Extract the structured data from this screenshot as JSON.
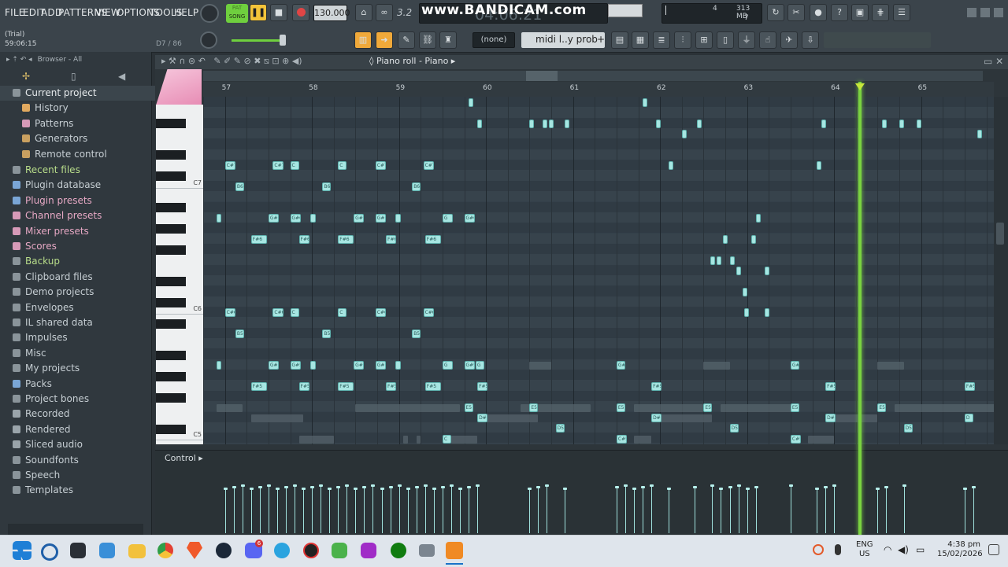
{
  "menu": [
    "FILE",
    "EDIT",
    "ADD",
    "PATTERNS",
    "VIEW",
    "OPTIONS",
    "TOOLS",
    "HELP"
  ],
  "transport": {
    "mode_label": "SONG",
    "mode_pat": "PAT",
    "tempo": "130.000",
    "time": "04:06:21",
    "pattern_num": "3.2"
  },
  "watermark": "www.BANDICAM.com",
  "cpu": {
    "value": "4",
    "memory": "313 MB",
    "voices": "7"
  },
  "hint": {
    "line1": "(Trial)",
    "line2": "59:06:15",
    "note": "D7 / 86"
  },
  "toolbar2": {
    "none_label": "(none)",
    "pattern_label": "midi l..y prob",
    "add_label": "+"
  },
  "browser": {
    "title": "Browser - All",
    "items": [
      {
        "label": "Current project",
        "style": "white",
        "indent": 0,
        "icon": "folder-icon"
      },
      {
        "label": "History",
        "style": "white",
        "indent": 1,
        "icon": "history-icon"
      },
      {
        "label": "Patterns",
        "style": "white",
        "indent": 1,
        "icon": "note-icon"
      },
      {
        "label": "Generators",
        "style": "white",
        "indent": 1,
        "icon": "generator-icon"
      },
      {
        "label": "Remote control",
        "style": "white",
        "indent": 1,
        "icon": "remote-icon"
      },
      {
        "label": "Recent files",
        "style": "green",
        "indent": 0,
        "icon": "folder-icon"
      },
      {
        "label": "Plugin database",
        "style": "white",
        "indent": 0,
        "icon": "plug-icon"
      },
      {
        "label": "Plugin presets",
        "style": "pink",
        "indent": 0,
        "icon": "plug-icon"
      },
      {
        "label": "Channel presets",
        "style": "pink",
        "indent": 0,
        "icon": "channel-icon"
      },
      {
        "label": "Mixer presets",
        "style": "pink",
        "indent": 0,
        "icon": "mixer-icon"
      },
      {
        "label": "Scores",
        "style": "pink",
        "indent": 0,
        "icon": "note-icon"
      },
      {
        "label": "Backup",
        "style": "green",
        "indent": 0,
        "icon": "folder-icon"
      },
      {
        "label": "Clipboard files",
        "style": "white",
        "indent": 0,
        "icon": "folder-icon"
      },
      {
        "label": "Demo projects",
        "style": "white",
        "indent": 0,
        "icon": "folder-icon"
      },
      {
        "label": "Envelopes",
        "style": "white",
        "indent": 0,
        "icon": "folder-icon"
      },
      {
        "label": "IL shared data",
        "style": "white",
        "indent": 0,
        "icon": "folder-icon"
      },
      {
        "label": "Impulses",
        "style": "white",
        "indent": 0,
        "icon": "folder-icon"
      },
      {
        "label": "Misc",
        "style": "white",
        "indent": 0,
        "icon": "folder-icon"
      },
      {
        "label": "My projects",
        "style": "white",
        "indent": 0,
        "icon": "folder-icon"
      },
      {
        "label": "Packs",
        "style": "white",
        "indent": 0,
        "icon": "pack-icon"
      },
      {
        "label": "Project bones",
        "style": "white",
        "indent": 0,
        "icon": "folder-icon"
      },
      {
        "label": "Recorded",
        "style": "white",
        "indent": 0,
        "icon": "plus-icon"
      },
      {
        "label": "Rendered",
        "style": "white",
        "indent": 0,
        "icon": "plus-icon"
      },
      {
        "label": "Sliced audio",
        "style": "white",
        "indent": 0,
        "icon": "plus-icon"
      },
      {
        "label": "Soundfonts",
        "style": "white",
        "indent": 0,
        "icon": "folder-icon"
      },
      {
        "label": "Speech",
        "style": "white",
        "indent": 0,
        "icon": "folder-icon"
      },
      {
        "label": "Templates",
        "style": "white",
        "indent": 0,
        "icon": "folder-icon"
      }
    ]
  },
  "pianoroll": {
    "title": "Piano roll - Piano",
    "control_label": "Control",
    "bars": [
      "57",
      "58",
      "59",
      "60",
      "61",
      "62",
      "63",
      "64",
      "65"
    ],
    "key_labels": [
      "C7",
      "C6",
      "C5"
    ],
    "playhead_bar": 64.3
  },
  "notes": [
    {
      "b": 57.0,
      "r": 7,
      "w": 0.12,
      "t": "C#7"
    },
    {
      "b": 57.55,
      "r": 7,
      "w": 0.12,
      "t": "C#7"
    },
    {
      "b": 57.75,
      "r": 7,
      "w": 0.1,
      "t": "C"
    },
    {
      "b": 58.3,
      "r": 7,
      "w": 0.1,
      "t": "C"
    },
    {
      "b": 58.73,
      "r": 7,
      "w": 0.12,
      "t": "C#7"
    },
    {
      "b": 59.28,
      "r": 7,
      "w": 0.12,
      "t": "C#7"
    },
    {
      "b": 57.12,
      "r": 9,
      "w": 0.1,
      "t": "B6"
    },
    {
      "b": 58.12,
      "r": 9,
      "w": 0.1,
      "t": "B6"
    },
    {
      "b": 59.15,
      "r": 9,
      "w": 0.1,
      "t": "B6"
    },
    {
      "b": 56.9,
      "r": 12,
      "w": 0.05,
      "t": ""
    },
    {
      "b": 57.5,
      "r": 12,
      "w": 0.12,
      "t": "G#6"
    },
    {
      "b": 57.75,
      "r": 12,
      "w": 0.12,
      "t": "G#6"
    },
    {
      "b": 57.98,
      "r": 12,
      "w": 0.06,
      "t": ""
    },
    {
      "b": 58.48,
      "r": 12,
      "w": 0.12,
      "t": "G#6"
    },
    {
      "b": 58.73,
      "r": 12,
      "w": 0.12,
      "t": "G#6"
    },
    {
      "b": 58.96,
      "r": 12,
      "w": 0.06,
      "t": ""
    },
    {
      "b": 59.5,
      "r": 12,
      "w": 0.12,
      "t": "G"
    },
    {
      "b": 59.75,
      "r": 12,
      "w": 0.12,
      "t": "G#6"
    },
    {
      "b": 57.3,
      "r": 14,
      "w": 0.18,
      "t": "F#6"
    },
    {
      "b": 57.85,
      "r": 14,
      "w": 0.12,
      "t": "F#6"
    },
    {
      "b": 58.3,
      "r": 14,
      "w": 0.18,
      "t": "F#6"
    },
    {
      "b": 58.85,
      "r": 14,
      "w": 0.12,
      "t": "F#6"
    },
    {
      "b": 59.3,
      "r": 14,
      "w": 0.18,
      "t": "F#6"
    },
    {
      "b": 57.0,
      "r": 21,
      "w": 0.12,
      "t": "C#6"
    },
    {
      "b": 57.55,
      "r": 21,
      "w": 0.12,
      "t": "C#6"
    },
    {
      "b": 57.75,
      "r": 21,
      "w": 0.1,
      "t": "C"
    },
    {
      "b": 58.3,
      "r": 21,
      "w": 0.1,
      "t": "C"
    },
    {
      "b": 58.73,
      "r": 21,
      "w": 0.12,
      "t": "C#6"
    },
    {
      "b": 59.28,
      "r": 21,
      "w": 0.12,
      "t": "C#6"
    },
    {
      "b": 57.12,
      "r": 23,
      "w": 0.1,
      "t": "B5"
    },
    {
      "b": 58.12,
      "r": 23,
      "w": 0.1,
      "t": "B5"
    },
    {
      "b": 59.15,
      "r": 23,
      "w": 0.1,
      "t": "B5"
    },
    {
      "b": 56.9,
      "r": 26,
      "w": 0.05,
      "t": ""
    },
    {
      "b": 57.5,
      "r": 26,
      "w": 0.12,
      "t": "G#5"
    },
    {
      "b": 57.75,
      "r": 26,
      "w": 0.12,
      "t": "G#5"
    },
    {
      "b": 57.98,
      "r": 26,
      "w": 0.06,
      "t": ""
    },
    {
      "b": 58.48,
      "r": 26,
      "w": 0.12,
      "t": "G#5"
    },
    {
      "b": 58.73,
      "r": 26,
      "w": 0.12,
      "t": "G#5"
    },
    {
      "b": 58.96,
      "r": 26,
      "w": 0.06,
      "t": ""
    },
    {
      "b": 59.5,
      "r": 26,
      "w": 0.12,
      "t": "G"
    },
    {
      "b": 59.75,
      "r": 26,
      "w": 0.12,
      "t": "G#5"
    },
    {
      "b": 59.88,
      "r": 26,
      "w": 0.1,
      "t": "G"
    },
    {
      "b": 61.5,
      "r": 26,
      "w": 0.1,
      "t": "G#"
    },
    {
      "b": 63.5,
      "r": 26,
      "w": 0.1,
      "t": "G#"
    },
    {
      "b": 57.3,
      "r": 28,
      "w": 0.18,
      "t": "F#5"
    },
    {
      "b": 57.85,
      "r": 28,
      "w": 0.12,
      "t": "F#5"
    },
    {
      "b": 58.3,
      "r": 28,
      "w": 0.18,
      "t": "F#5"
    },
    {
      "b": 58.85,
      "r": 28,
      "w": 0.12,
      "t": "F#5"
    },
    {
      "b": 59.3,
      "r": 28,
      "w": 0.18,
      "t": "F#5"
    },
    {
      "b": 59.9,
      "r": 28,
      "w": 0.12,
      "t": "F#5"
    },
    {
      "b": 61.9,
      "r": 28,
      "w": 0.12,
      "t": "F#5"
    },
    {
      "b": 63.9,
      "r": 28,
      "w": 0.12,
      "t": "F#5"
    },
    {
      "b": 65.5,
      "r": 28,
      "w": 0.12,
      "t": "F#5"
    },
    {
      "b": 59.75,
      "r": 30,
      "w": 0.1,
      "t": "E5"
    },
    {
      "b": 60.5,
      "r": 30,
      "w": 0.1,
      "t": "E5"
    },
    {
      "b": 61.5,
      "r": 30,
      "w": 0.1,
      "t": "E5"
    },
    {
      "b": 62.5,
      "r": 30,
      "w": 0.1,
      "t": "E5"
    },
    {
      "b": 63.5,
      "r": 30,
      "w": 0.1,
      "t": "E5"
    },
    {
      "b": 64.5,
      "r": 30,
      "w": 0.1,
      "t": "E5"
    },
    {
      "b": 59.9,
      "r": 31,
      "w": 0.12,
      "t": "D#5"
    },
    {
      "b": 61.9,
      "r": 31,
      "w": 0.12,
      "t": "D#5"
    },
    {
      "b": 63.9,
      "r": 31,
      "w": 0.12,
      "t": "D#5"
    },
    {
      "b": 65.5,
      "r": 31,
      "w": 0.1,
      "t": "D"
    },
    {
      "b": 60.8,
      "r": 32,
      "w": 0.1,
      "t": "D5"
    },
    {
      "b": 62.8,
      "r": 32,
      "w": 0.1,
      "t": "D5"
    },
    {
      "b": 64.8,
      "r": 32,
      "w": 0.1,
      "t": "D5"
    },
    {
      "b": 59.5,
      "r": 33,
      "w": 0.1,
      "t": "C"
    },
    {
      "b": 61.5,
      "r": 33,
      "w": 0.12,
      "t": "C#5"
    },
    {
      "b": 63.5,
      "r": 33,
      "w": 0.12,
      "t": "C#5"
    },
    {
      "b": 59.9,
      "r": 34,
      "w": 0.12,
      "t": "C5"
    },
    {
      "b": 61.9,
      "r": 34,
      "w": 0.12,
      "t": "C5"
    },
    {
      "b": 63.9,
      "r": 34,
      "w": 0.1,
      "t": "C5"
    },
    {
      "b": 65.5,
      "r": 34,
      "w": 0.1,
      "t": "C5"
    }
  ],
  "small_notes": [
    {
      "b": 59.8,
      "r": 1
    },
    {
      "b": 61.8,
      "r": 1
    },
    {
      "b": 59.9,
      "r": 3
    },
    {
      "b": 60.5,
      "r": 3
    },
    {
      "b": 60.65,
      "r": 3
    },
    {
      "b": 60.72,
      "r": 3
    },
    {
      "b": 60.9,
      "r": 3
    },
    {
      "b": 61.95,
      "r": 3
    },
    {
      "b": 62.42,
      "r": 3
    },
    {
      "b": 63.85,
      "r": 3
    },
    {
      "b": 64.55,
      "r": 3
    },
    {
      "b": 64.75,
      "r": 3
    },
    {
      "b": 64.95,
      "r": 3
    },
    {
      "b": 62.25,
      "r": 4
    },
    {
      "b": 65.65,
      "r": 4
    },
    {
      "b": 62.1,
      "r": 7
    },
    {
      "b": 63.8,
      "r": 7
    },
    {
      "b": 63.1,
      "r": 12
    },
    {
      "b": 62.72,
      "r": 14
    },
    {
      "b": 63.05,
      "r": 14
    },
    {
      "b": 62.58,
      "r": 16
    },
    {
      "b": 62.65,
      "r": 16
    },
    {
      "b": 62.8,
      "r": 16
    },
    {
      "b": 62.88,
      "r": 17
    },
    {
      "b": 63.2,
      "r": 17
    },
    {
      "b": 62.95,
      "r": 19
    },
    {
      "b": 62.97,
      "r": 21
    },
    {
      "b": 63.2,
      "r": 21
    }
  ],
  "ghosts": [
    {
      "b": 60.5,
      "r": 26,
      "w": 0.25
    },
    {
      "b": 62.5,
      "r": 26,
      "w": 0.3
    },
    {
      "b": 64.5,
      "r": 26,
      "w": 0.3
    },
    {
      "b": 56.9,
      "r": 30,
      "w": 0.3
    },
    {
      "b": 58.5,
      "r": 30,
      "w": 1.2
    },
    {
      "b": 60.4,
      "r": 30,
      "w": 0.8
    },
    {
      "b": 61.7,
      "r": 30,
      "w": 0.8
    },
    {
      "b": 62.7,
      "r": 30,
      "w": 0.9
    },
    {
      "b": 64.7,
      "r": 30,
      "w": 1.2
    },
    {
      "b": 57.3,
      "r": 31,
      "w": 0.6
    },
    {
      "b": 60.0,
      "r": 31,
      "w": 0.6
    },
    {
      "b": 62.0,
      "r": 31,
      "w": 0.6
    },
    {
      "b": 64.0,
      "r": 31,
      "w": 0.5
    },
    {
      "b": 57.85,
      "r": 33,
      "w": 0.4
    },
    {
      "b": 59.05,
      "r": 33,
      "w": 0.05
    },
    {
      "b": 59.2,
      "r": 33,
      "w": 0.05
    },
    {
      "b": 59.6,
      "r": 33,
      "w": 0.3
    },
    {
      "b": 61.7,
      "r": 33,
      "w": 0.2
    },
    {
      "b": 63.7,
      "r": 33,
      "w": 0.3
    },
    {
      "b": 58.45,
      "r": 34,
      "w": 0.6
    },
    {
      "b": 60.0,
      "r": 34,
      "w": 0.5
    },
    {
      "b": 62.0,
      "r": 34,
      "w": 0.6
    },
    {
      "b": 64.0,
      "r": 34,
      "w": 0.8
    }
  ],
  "velocity_ticks": [
    57.0,
    57.1,
    57.2,
    57.3,
    57.4,
    57.5,
    57.6,
    57.7,
    57.8,
    57.9,
    58.0,
    58.1,
    58.2,
    58.3,
    58.4,
    58.5,
    58.6,
    58.7,
    58.8,
    58.9,
    59.0,
    59.1,
    59.2,
    59.3,
    59.4,
    59.5,
    59.6,
    59.7,
    59.8,
    59.9,
    60.5,
    60.6,
    60.7,
    60.9,
    61.5,
    61.6,
    61.7,
    61.8,
    61.9,
    62.1,
    62.4,
    62.6,
    62.7,
    62.8,
    62.9,
    63.0,
    63.1,
    63.5,
    63.8,
    63.9,
    64.0,
    64.5,
    64.6,
    64.8,
    65.5,
    65.6
  ],
  "taskbar": {
    "lang1": "ENG",
    "lang2": "US",
    "time": "4:38 pm",
    "date": "15/02/2026",
    "badge": "6"
  }
}
